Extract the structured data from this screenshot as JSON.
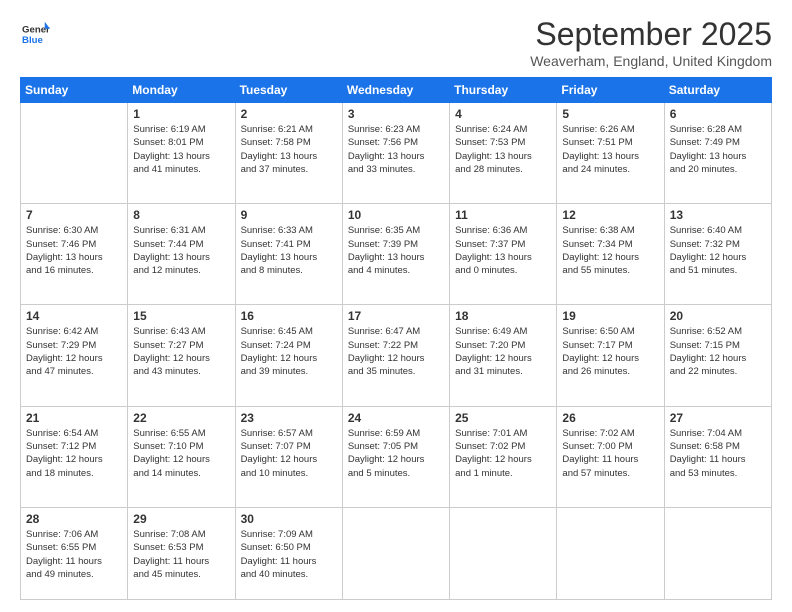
{
  "logo": {
    "general": "General",
    "blue": "Blue"
  },
  "title": "September 2025",
  "location": "Weaverham, England, United Kingdom",
  "days_of_week": [
    "Sunday",
    "Monday",
    "Tuesday",
    "Wednesday",
    "Thursday",
    "Friday",
    "Saturday"
  ],
  "weeks": [
    [
      {
        "day": "",
        "info": ""
      },
      {
        "day": "1",
        "info": "Sunrise: 6:19 AM\nSunset: 8:01 PM\nDaylight: 13 hours\nand 41 minutes."
      },
      {
        "day": "2",
        "info": "Sunrise: 6:21 AM\nSunset: 7:58 PM\nDaylight: 13 hours\nand 37 minutes."
      },
      {
        "day": "3",
        "info": "Sunrise: 6:23 AM\nSunset: 7:56 PM\nDaylight: 13 hours\nand 33 minutes."
      },
      {
        "day": "4",
        "info": "Sunrise: 6:24 AM\nSunset: 7:53 PM\nDaylight: 13 hours\nand 28 minutes."
      },
      {
        "day": "5",
        "info": "Sunrise: 6:26 AM\nSunset: 7:51 PM\nDaylight: 13 hours\nand 24 minutes."
      },
      {
        "day": "6",
        "info": "Sunrise: 6:28 AM\nSunset: 7:49 PM\nDaylight: 13 hours\nand 20 minutes."
      }
    ],
    [
      {
        "day": "7",
        "info": "Sunrise: 6:30 AM\nSunset: 7:46 PM\nDaylight: 13 hours\nand 16 minutes."
      },
      {
        "day": "8",
        "info": "Sunrise: 6:31 AM\nSunset: 7:44 PM\nDaylight: 13 hours\nand 12 minutes."
      },
      {
        "day": "9",
        "info": "Sunrise: 6:33 AM\nSunset: 7:41 PM\nDaylight: 13 hours\nand 8 minutes."
      },
      {
        "day": "10",
        "info": "Sunrise: 6:35 AM\nSunset: 7:39 PM\nDaylight: 13 hours\nand 4 minutes."
      },
      {
        "day": "11",
        "info": "Sunrise: 6:36 AM\nSunset: 7:37 PM\nDaylight: 13 hours\nand 0 minutes."
      },
      {
        "day": "12",
        "info": "Sunrise: 6:38 AM\nSunset: 7:34 PM\nDaylight: 12 hours\nand 55 minutes."
      },
      {
        "day": "13",
        "info": "Sunrise: 6:40 AM\nSunset: 7:32 PM\nDaylight: 12 hours\nand 51 minutes."
      }
    ],
    [
      {
        "day": "14",
        "info": "Sunrise: 6:42 AM\nSunset: 7:29 PM\nDaylight: 12 hours\nand 47 minutes."
      },
      {
        "day": "15",
        "info": "Sunrise: 6:43 AM\nSunset: 7:27 PM\nDaylight: 12 hours\nand 43 minutes."
      },
      {
        "day": "16",
        "info": "Sunrise: 6:45 AM\nSunset: 7:24 PM\nDaylight: 12 hours\nand 39 minutes."
      },
      {
        "day": "17",
        "info": "Sunrise: 6:47 AM\nSunset: 7:22 PM\nDaylight: 12 hours\nand 35 minutes."
      },
      {
        "day": "18",
        "info": "Sunrise: 6:49 AM\nSunset: 7:20 PM\nDaylight: 12 hours\nand 31 minutes."
      },
      {
        "day": "19",
        "info": "Sunrise: 6:50 AM\nSunset: 7:17 PM\nDaylight: 12 hours\nand 26 minutes."
      },
      {
        "day": "20",
        "info": "Sunrise: 6:52 AM\nSunset: 7:15 PM\nDaylight: 12 hours\nand 22 minutes."
      }
    ],
    [
      {
        "day": "21",
        "info": "Sunrise: 6:54 AM\nSunset: 7:12 PM\nDaylight: 12 hours\nand 18 minutes."
      },
      {
        "day": "22",
        "info": "Sunrise: 6:55 AM\nSunset: 7:10 PM\nDaylight: 12 hours\nand 14 minutes."
      },
      {
        "day": "23",
        "info": "Sunrise: 6:57 AM\nSunset: 7:07 PM\nDaylight: 12 hours\nand 10 minutes."
      },
      {
        "day": "24",
        "info": "Sunrise: 6:59 AM\nSunset: 7:05 PM\nDaylight: 12 hours\nand 5 minutes."
      },
      {
        "day": "25",
        "info": "Sunrise: 7:01 AM\nSunset: 7:02 PM\nDaylight: 12 hours\nand 1 minute."
      },
      {
        "day": "26",
        "info": "Sunrise: 7:02 AM\nSunset: 7:00 PM\nDaylight: 11 hours\nand 57 minutes."
      },
      {
        "day": "27",
        "info": "Sunrise: 7:04 AM\nSunset: 6:58 PM\nDaylight: 11 hours\nand 53 minutes."
      }
    ],
    [
      {
        "day": "28",
        "info": "Sunrise: 7:06 AM\nSunset: 6:55 PM\nDaylight: 11 hours\nand 49 minutes."
      },
      {
        "day": "29",
        "info": "Sunrise: 7:08 AM\nSunset: 6:53 PM\nDaylight: 11 hours\nand 45 minutes."
      },
      {
        "day": "30",
        "info": "Sunrise: 7:09 AM\nSunset: 6:50 PM\nDaylight: 11 hours\nand 40 minutes."
      },
      {
        "day": "",
        "info": ""
      },
      {
        "day": "",
        "info": ""
      },
      {
        "day": "",
        "info": ""
      },
      {
        "day": "",
        "info": ""
      }
    ]
  ]
}
